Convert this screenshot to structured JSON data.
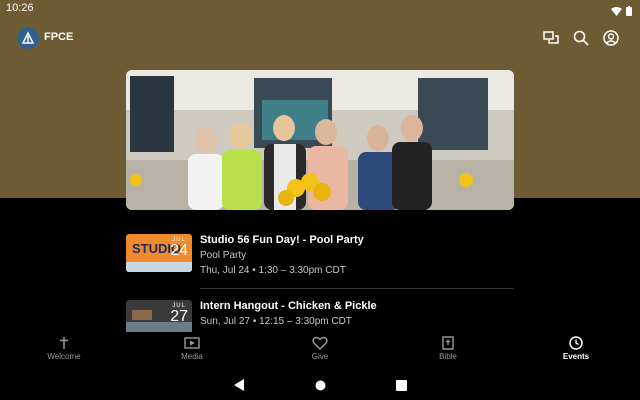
{
  "status": {
    "time": "10:26"
  },
  "app": {
    "title": "FPCE"
  },
  "colors": {
    "header_bg": "#6e5a33",
    "accent": "#ffffff",
    "muted": "#999999"
  },
  "appbar_icons": [
    "chat-icon",
    "search-icon",
    "account-icon"
  ],
  "events": [
    {
      "title": "Studio 56 Fun Day! - Pool Party",
      "subtitle": "Pool Party",
      "datetime": "Thu, Jul 24 • 1:30 – 3:30pm CDT",
      "month": "JUL",
      "day": "24",
      "thumb_text": "STUDIO"
    },
    {
      "title": "Intern Hangout - Chicken & Pickle",
      "subtitle": "",
      "datetime": "Sun, Jul 27 • 12:15 – 3:30pm CDT",
      "month": "JUL",
      "day": "27",
      "thumb_text": ""
    }
  ],
  "nav": [
    {
      "label": "Welcome",
      "icon": "cross-icon",
      "active": false
    },
    {
      "label": "Media",
      "icon": "media-icon",
      "active": false
    },
    {
      "label": "Give",
      "icon": "heart-icon",
      "active": false
    },
    {
      "label": "Bible",
      "icon": "bible-icon",
      "active": false
    },
    {
      "label": "Events",
      "icon": "clock-icon",
      "active": true
    }
  ]
}
